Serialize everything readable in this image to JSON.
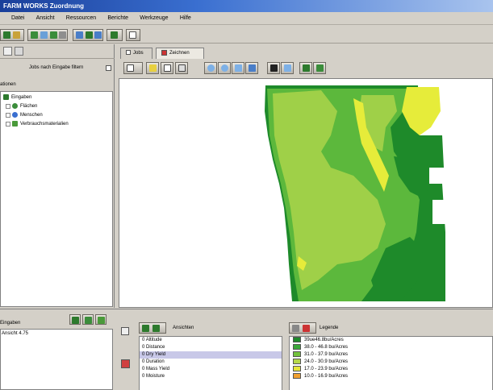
{
  "window": {
    "title": "FARM WORKS Zuordnung"
  },
  "menu": [
    "Datei",
    "Ansicht",
    "Ressourcen",
    "Berichte",
    "Werkzeuge",
    "Hilfe"
  ],
  "left": {
    "filter_label": "Jobs nach Eingabe filtern",
    "tree_header": "ationen",
    "tree": [
      "Eingaben",
      "Flächen",
      "Menschen",
      "Verbrauchsmaterialien"
    ]
  },
  "tabs": [
    "Jobs",
    "Zeichnen"
  ],
  "bottom": {
    "left_label": "Eingaben",
    "left_value": "Ansicht 4.75",
    "attributes_title": "Ansichten",
    "attributes": [
      "Altitude",
      "Distance",
      "Dry Yield",
      "Duration",
      "Mass Yield",
      "Moisture"
    ],
    "selected_attribute": "Dry Yield",
    "legend_title": "Legende",
    "legend": [
      {
        "label": "39ue46.8bu/Acres",
        "color": "#1e8a2a"
      },
      {
        "label": "38.0 - 46.8 bu/Acres",
        "color": "#3aa83a"
      },
      {
        "label": "31.0 - 37.9 bu/Acres",
        "color": "#73c23c"
      },
      {
        "label": "24.0 - 30.9 bu/Acres",
        "color": "#b5d84a"
      },
      {
        "label": "17.0 - 23.9 bu/Acres",
        "color": "#e6e63a"
      },
      {
        "label": "10.0 - 16.9 bu/Acres",
        "color": "#f0a030"
      }
    ]
  },
  "colors": {
    "map_dark": "#1e8a2a",
    "map_mid": "#5cb83c",
    "map_light": "#9fd048",
    "map_yellow": "#e6ec3a"
  }
}
